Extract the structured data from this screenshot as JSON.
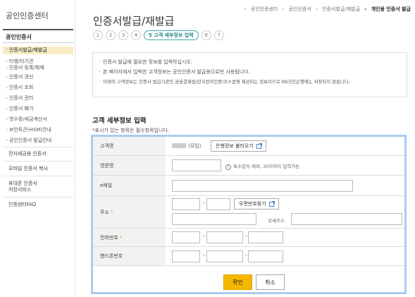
{
  "sidebar": {
    "title": "공인인증센터",
    "section_label": "공인인증서",
    "items": [
      {
        "label": "인증서발급/재발급",
        "active": true
      },
      {
        "label": "타행/타기관"
      },
      {
        "label": "인증서 등록/해제"
      },
      {
        "label": "인증서 갱신"
      },
      {
        "label": "인증서 조회"
      },
      {
        "label": "인증서 관리"
      },
      {
        "label": "인증서 폐기"
      },
      {
        "label": "영수증/세금계산서"
      },
      {
        "label": "보안토큰(HSM)안내"
      },
      {
        "label": "공인인증서 발급안내"
      }
    ],
    "main_links": [
      {
        "label": "전자세금용 인증서"
      },
      {
        "label": "모바일 인증서 복사"
      },
      {
        "label": "휴대폰 인증서"
      },
      {
        "label": "저장서비스"
      },
      {
        "label": "인증센터FAQ"
      }
    ]
  },
  "breadcrumb": [
    "공인인증센터",
    "공인인증서",
    "인증서발급/재발급",
    "개인용 인증서 발급"
  ],
  "page_title": "인증서발급/재발급",
  "steps": [
    "1",
    "2",
    "3",
    "4",
    "5 고객 세부정보 입력",
    "6",
    "7"
  ],
  "notice": [
    "인증서 발급에 필요한 정보를 입력하십시오.",
    "본 페이지에서 입력한 고객정보는 공인인증서 발급용으로만 사용됩니다.",
    "아래의 고객정보는 인증서 발급기관인 금융결제원/한국전자인증/코스콤에 제공되는 정보이므로 KB국민은행에는 저장되지 않습니다."
  ],
  "section_title": "고객 세부정보 입력",
  "required_note": "*표시가 있는 항목은 필수항목입니다.",
  "form": {
    "name_label": "고객명",
    "name_suffix": "(모임)",
    "bank_info_button": "은행정보 불러오기",
    "english_name_label": "영문명",
    "english_name_hint": "특수문자 제외, 30자까지 입력가능",
    "email_label": "e메일",
    "address_label": "주소",
    "zip_button": "우편번호찾기",
    "address_detail_label": "상세주소",
    "phone_label": "전화번호",
    "mobile_label": "핸드폰번호",
    "ok_button": "확인",
    "cancel_button": "취소"
  },
  "colors": {
    "accent": "#f5b800",
    "form_border": "#a7cdf0",
    "active_menu": "#f7ecc2",
    "active_step": "#3fa6a6"
  }
}
